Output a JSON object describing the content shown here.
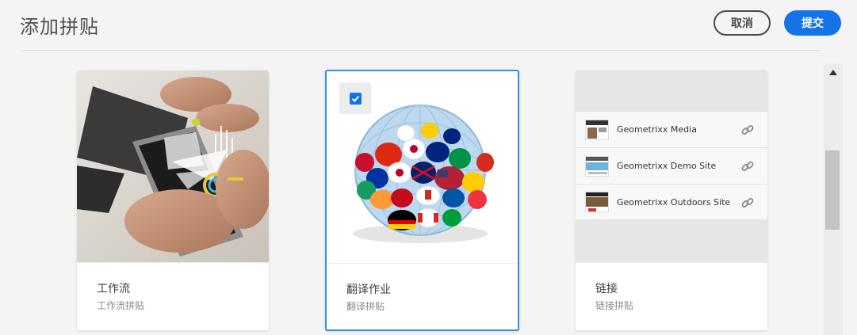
{
  "header": {
    "title": "添加拼贴",
    "cancel_label": "取消",
    "submit_label": "提交"
  },
  "cards": [
    {
      "title": "工作流",
      "subtitle": "工作流拼贴",
      "selected": false
    },
    {
      "title": "翻译作业",
      "subtitle": "翻译拼贴",
      "selected": true
    },
    {
      "title": "链接",
      "subtitle": "链接拼贴",
      "selected": false,
      "links": [
        {
          "label": "Geometrixx Media"
        },
        {
          "label": "Geometrixx Demo Site"
        },
        {
          "label": "Geometrixx Outdoors Site"
        }
      ]
    }
  ],
  "colors": {
    "accent": "#1473e6",
    "selected_border": "#378ef0",
    "background": "#f4f4f4"
  },
  "icons": [
    "checkbox-checked-icon",
    "link-icon",
    "scroll-up-arrow-icon"
  ]
}
